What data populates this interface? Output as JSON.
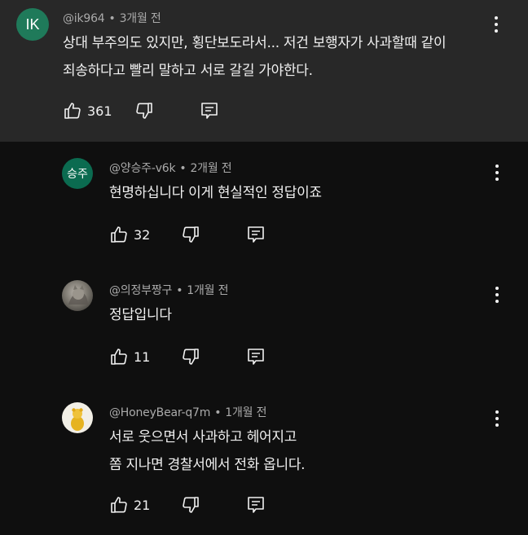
{
  "colors": {
    "page_bg": "#0f0f0f",
    "highlight_bg": "#282828",
    "text_primary": "#f1f1f1",
    "text_secondary": "#aaaaaa",
    "avatar_ik": "#1f7a5a",
    "avatar_seungju": "#0b6b50"
  },
  "comments": [
    {
      "author": "@ik964",
      "time": "3개월 전",
      "avatar_text": "IK",
      "lines": [
        "상대 부주의도 있지만, 횡단보도라서... 저건 보행자가 사과할때 같이",
        "죄송하다고 빨리 말하고 서로 갈길 가야한다."
      ],
      "likes": "361",
      "icons": {
        "like": "thumbs-up-icon",
        "dislike": "thumbs-down-icon",
        "reply": "reply-icon",
        "menu": "more-vert-icon"
      }
    },
    {
      "author": "@양승주-v6k",
      "time": "2개월 전",
      "avatar_text": "승주",
      "lines": [
        "현명하십니다 이게 현실적인 정답이죠"
      ],
      "likes": "32"
    },
    {
      "author": "@의정부짱구",
      "time": "1개월 전",
      "avatar_text": "",
      "lines": [
        "정답입니다"
      ],
      "likes": "11"
    },
    {
      "author": "@HoneyBear-q7m",
      "time": "1개월 전",
      "avatar_text": "",
      "lines": [
        "서로 웃으면서 사과하고 헤어지고",
        "쫌 지나면 경찰서에서 전화 옵니다."
      ],
      "likes": "21"
    }
  ]
}
